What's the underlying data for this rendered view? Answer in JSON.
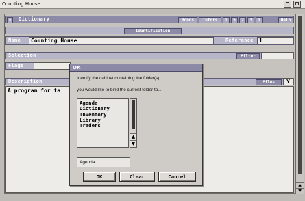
{
  "window": {
    "title": "Counting House"
  },
  "toolbar": {
    "dictionary_label": "Dictionary",
    "bonds_label": "Bonds",
    "tutors_label": "Tutors",
    "page_numbers": [
      "1",
      "5",
      "2",
      "3",
      "1"
    ],
    "help_label": "Help"
  },
  "identification": {
    "section_label": "Identification",
    "name_label": "Name",
    "name_value": "Counting House",
    "reference_label": "Reference",
    "reference_value": "1"
  },
  "selection": {
    "label": "Selection",
    "filter_label": "Filter",
    "flags_label": "Flags"
  },
  "description": {
    "label": "Description",
    "value": "A program for ta",
    "files_label": "Files",
    "files_value": "Y"
  },
  "dialog": {
    "title": "OK",
    "message_line1": "Identify the cabinet containing the folder(s)",
    "message_line2": "you would like to bind the current folder to...",
    "cabinets": [
      "Agenda",
      "Dictionary",
      "Inventory",
      "Library",
      "Traders"
    ],
    "entry_value": "Agenda",
    "ok_label": "OK",
    "clear_label": "Clear",
    "cancel_label": "Cancel"
  },
  "colors": {
    "strip": "#8c8aa6",
    "field": "#eeece8",
    "background": "#c6c3be"
  }
}
